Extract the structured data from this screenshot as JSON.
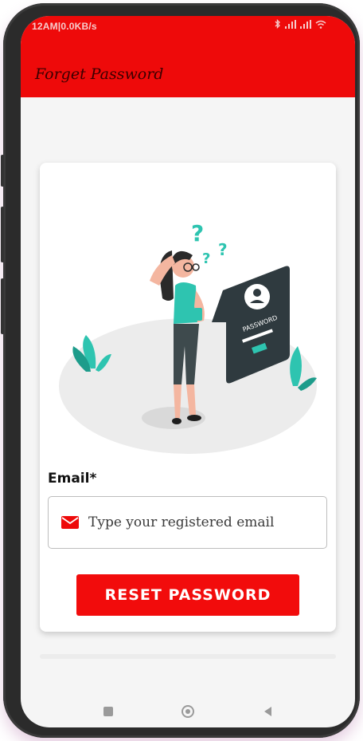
{
  "status_bar": {
    "left_text": "12AM|0.0KB/s",
    "icons": [
      "alarm-icon",
      "settings-icon",
      "bluetooth-icon",
      "signal-icon",
      "signal-icon",
      "wifi-icon"
    ]
  },
  "app_bar": {
    "title": "Forget Password",
    "background_color": "#ee0a0a"
  },
  "illustration": {
    "text": "PASSWORD"
  },
  "form": {
    "email_label": "Email*",
    "email_placeholder": "Type your registered email",
    "email_value": "",
    "reset_button_label": "RESET PASSWORD"
  },
  "nav_bar": {
    "buttons": [
      "recent-apps-icon",
      "home-icon",
      "back-icon"
    ]
  },
  "colors": {
    "accent": "#ee0a0a",
    "illustration_teal": "#2ec4b0"
  }
}
